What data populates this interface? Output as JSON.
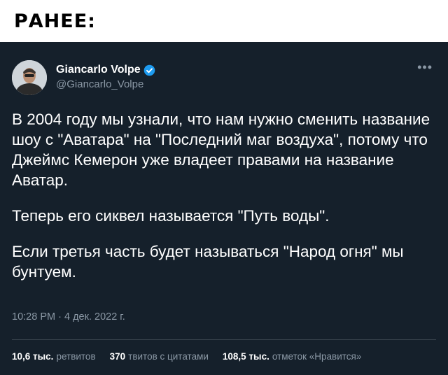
{
  "banner": {
    "label": "РАНЕЕ:"
  },
  "tweet": {
    "display_name": "Giancarlo Volpe",
    "handle": "@Giancarlo_Volpe",
    "paragraphs": [
      "В 2004 году мы узнали, что нам нужно сменить название шоу с \"Аватара\" на \"Последний маг воздуха\", потому что Джеймс Кемерон уже владеет правами на название Аватар.",
      "Теперь его сиквел называется \"Путь воды\".",
      "Если третья часть будет называться \"Народ огня\" мы бунтуем."
    ],
    "time": "10:28 PM",
    "separator": "·",
    "date": "4 дек. 2022 г.",
    "stats": {
      "retweets_count": "10,6 тыс.",
      "retweets_label": "ретвитов",
      "quotes_count": "370",
      "quotes_label": "твитов с цитатами",
      "likes_count": "108,5 тыс.",
      "likes_label": "отметок «Нравится»"
    }
  },
  "colors": {
    "background": "#15202b",
    "muted": "#8b98a5",
    "verified": "#1d9bf0"
  },
  "icons": {
    "verified": "verified-badge-icon",
    "more": "more-options-icon"
  }
}
